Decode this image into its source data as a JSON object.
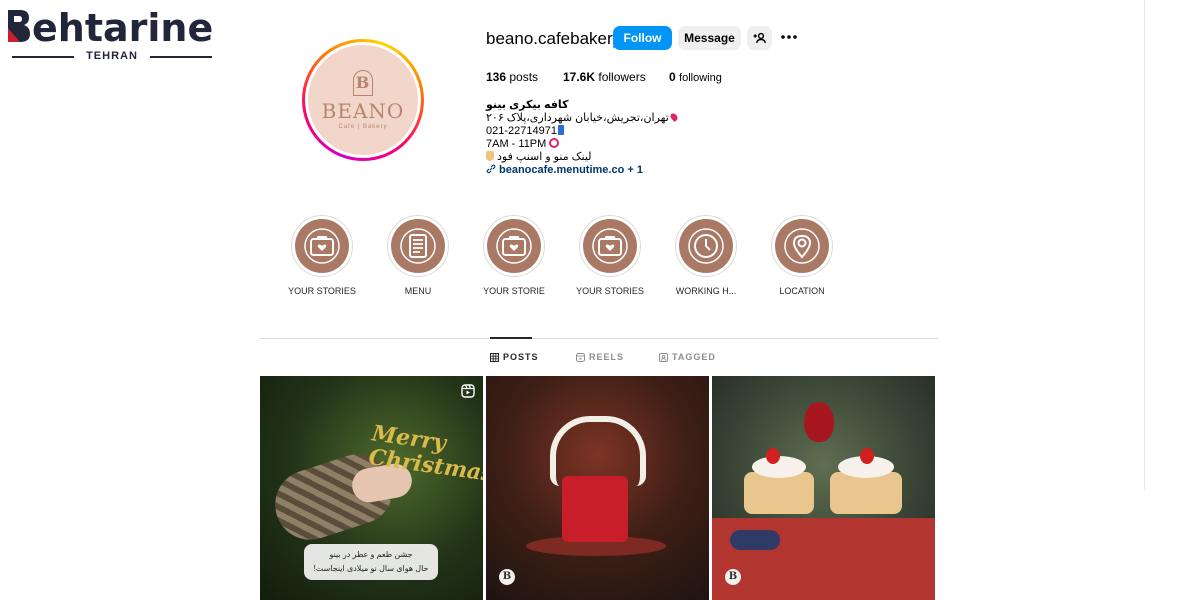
{
  "watermark": {
    "brand": "ehtarine",
    "brand_initial": "B",
    "city": "TEHRAN"
  },
  "profile": {
    "username": "beano.cafebakery",
    "avatar": {
      "initial": "B",
      "name": "BEANO",
      "subtitle": "Cafe | Bakery"
    },
    "buttons": {
      "follow": "Follow",
      "message": "Message"
    },
    "icons": {
      "add_user": "add-user-icon",
      "more": "more-icon"
    }
  },
  "stats": {
    "posts_count": "136",
    "posts_label": "posts",
    "followers_count": "17.6K",
    "followers_label": "followers",
    "following_count": "0",
    "following_label": "following"
  },
  "bio": {
    "name": "کافه بیکری بینو",
    "address": "تهران،تجریش،خیابان شهرداری،پلاک ۲۰۶",
    "phone": "021-22714971",
    "hours": "7AM - 11PM",
    "menu_line": "لینک منو و اسنپ فود",
    "link": "beanocafe.menutime.co",
    "link_more": " + 1"
  },
  "highlights": [
    {
      "label": "YOUR STORIES",
      "icon": "camera-heart-icon"
    },
    {
      "label": "MENU",
      "icon": "menu-list-icon"
    },
    {
      "label": "YOUR STORIE",
      "icon": "camera-heart-icon"
    },
    {
      "label": "YOUR STORIES",
      "icon": "camera-heart-icon"
    },
    {
      "label": "WORKING H...",
      "icon": "clock-icon"
    },
    {
      "label": "LOCATION",
      "icon": "location-pin-icon"
    }
  ],
  "tabs": [
    {
      "label": "POSTS",
      "active": true,
      "icon": "grid-icon"
    },
    {
      "label": "REELS",
      "active": false,
      "icon": "reels-icon"
    },
    {
      "label": "TAGGED",
      "active": false,
      "icon": "tagged-icon"
    }
  ],
  "posts": [
    {
      "type": "reel",
      "overlay_script": "Merry Christmas",
      "caption_line1": "جشن طعم و عطر در بینو",
      "caption_line2": "حال هوای سال نو میلادی اینجاست!"
    },
    {
      "type": "photo",
      "logo": "B"
    },
    {
      "type": "photo",
      "logo": "B"
    }
  ],
  "colors": {
    "follow_blue": "#0095f6",
    "highlight_brown": "#a97966",
    "link_blue": "#00376b",
    "avatar_bg": "#f2d6c9"
  }
}
